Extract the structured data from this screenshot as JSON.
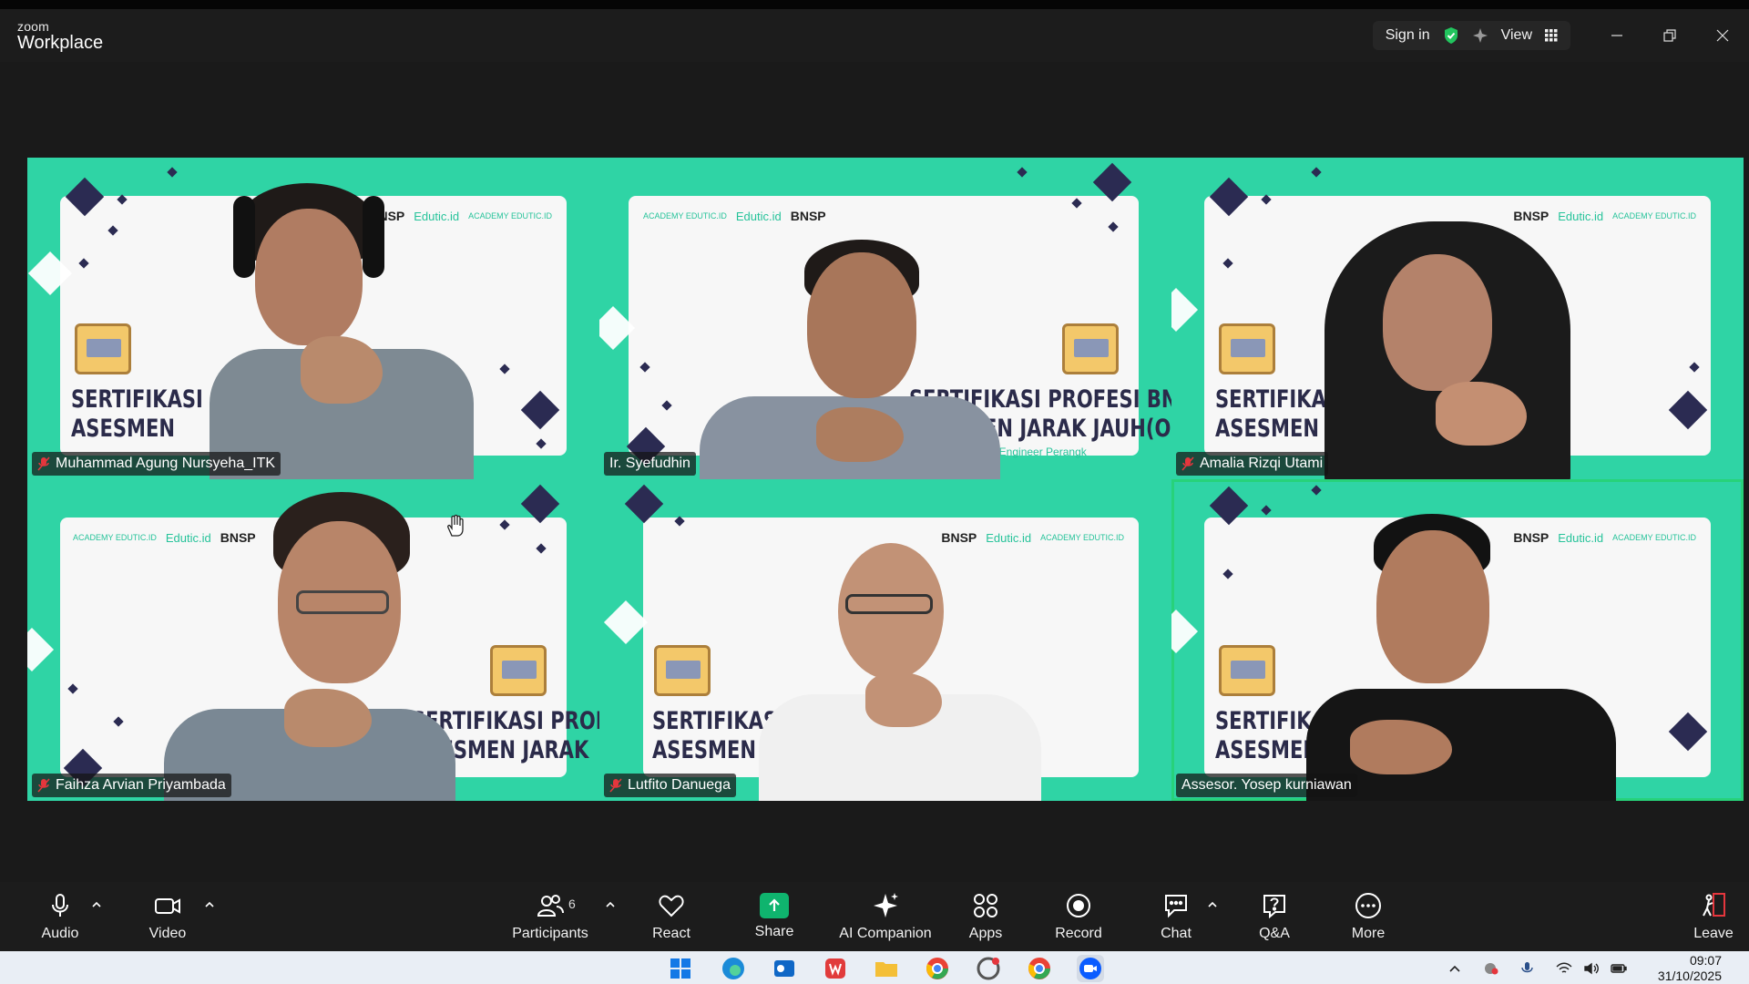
{
  "app": {
    "brand_small": "zoom",
    "brand_large": "Workplace"
  },
  "titlebar": {
    "sign_in_label": "Sign in",
    "view_label": "View"
  },
  "participants": [
    {
      "name": "Muhammad Agung Nursyeha_ITK",
      "muted": true
    },
    {
      "name": "Ir. Syefudhin",
      "muted": false
    },
    {
      "name": "Amalia Rizqi Utami",
      "muted": true
    },
    {
      "name": "Faihza Arvian Priyambada",
      "muted": true
    },
    {
      "name": "Lutfito Danuega",
      "muted": true
    },
    {
      "name": "Assesor. Yosep kurniawan",
      "muted": false
    }
  ],
  "background": {
    "logo_bnsp": "BNSP",
    "logo_edutic": "Edutic.id",
    "logo_academy": "ACADEMY EDUTIC.ID",
    "line1_cut": "SERTIFIKASI P",
    "line2_cut": "ASESMEN",
    "line1_mirror": "SERTIFIKASI PROFESI BNSP",
    "line2_mirror": "ASESMEN JARAK JAUH(ON",
    "subtitle_mirror": "Skema Engineer Perangk",
    "line1_b": "SERTIFIKASI PROFE",
    "line2_b": "ASESMEN JARAK",
    "line1_c": "SERTIFIKASI PROF",
    "line2_c": "ASESMEN JARAK",
    "line1_d": "SERTIFIKASI PROFESI",
    "line2_d": "ASESMEN JARAK",
    "line1_e": "SERTIFIKASI",
    "line2_e": "ASESMEN"
  },
  "toolbar": {
    "audio": "Audio",
    "video": "Video",
    "participants": "Participants",
    "participants_count": "6",
    "react": "React",
    "share": "Share",
    "ai_companion": "AI Companion",
    "apps": "Apps",
    "record": "Record",
    "chat": "Chat",
    "qa": "Q&A",
    "more": "More",
    "leave": "Leave"
  },
  "colors": {
    "tile_green": "#2fd4a5",
    "active_speaker": "#27d27a",
    "share_green": "#0fb46e",
    "leave_red": "#e5363d"
  },
  "taskbar": {
    "time": "09:07",
    "date": "31/10/2025"
  }
}
